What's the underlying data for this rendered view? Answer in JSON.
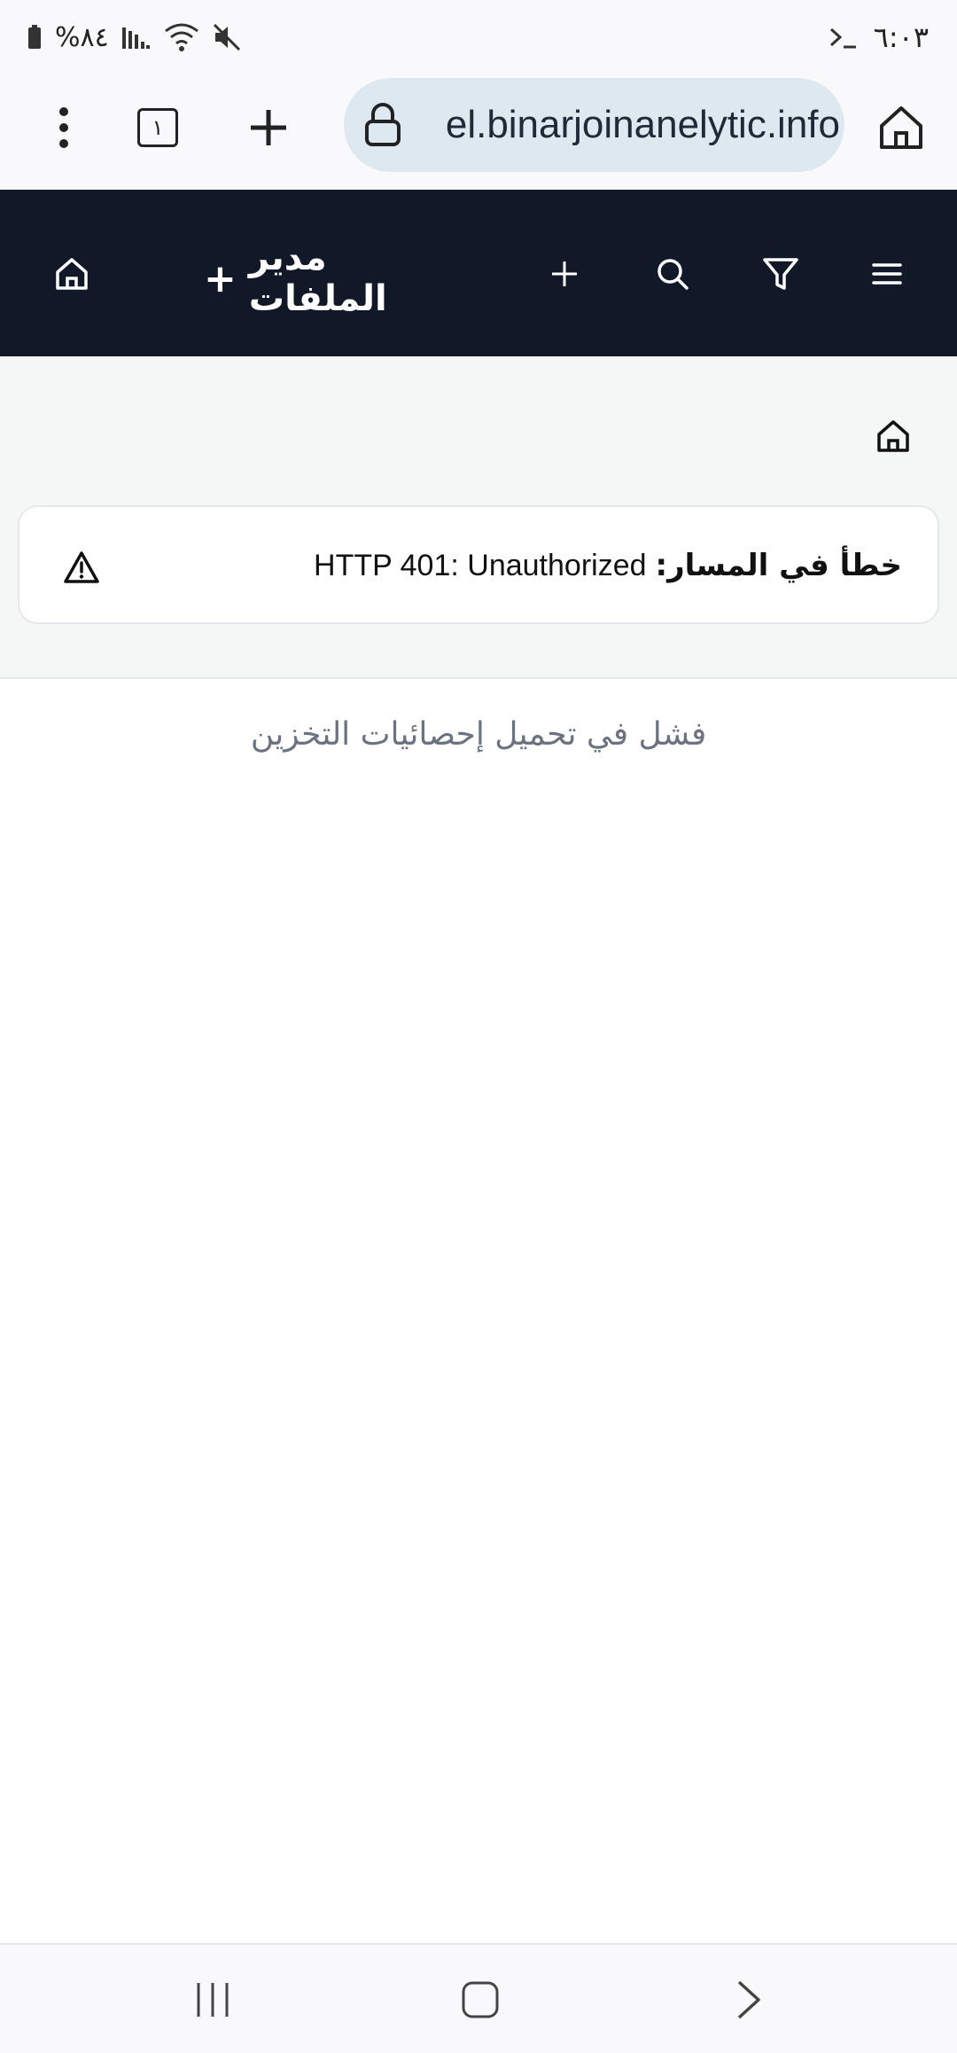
{
  "status_bar": {
    "time": "٦:٠٣",
    "battery": "%٨٤",
    "terminal_icon": "terminal-icon",
    "icons": [
      "battery-icon",
      "signal-icon",
      "wifi-icon",
      "mute-icon"
    ]
  },
  "browser": {
    "url": "el.binarjoinanelytic.info",
    "tab_count": "١",
    "icons": [
      "home-icon",
      "lock-icon",
      "plus-icon",
      "tabs-icon",
      "more-vert-icon"
    ]
  },
  "header": {
    "title": "مدير الملفات",
    "title_plus": "+",
    "icons": [
      "menu-icon",
      "filter-icon",
      "search-icon",
      "plus-icon",
      "home-icon"
    ],
    "background": "#111827"
  },
  "breadcrumb": {
    "icon": "home-icon"
  },
  "error": {
    "label": "خطأ في المسار:",
    "detail": "HTTP 401: Unauthorized",
    "icon": "warning-icon"
  },
  "storage": {
    "message": "فشل في تحميل إحصائيات التخزين"
  },
  "nav": {
    "icons": [
      "recents-icon",
      "home-nav-icon",
      "back-icon"
    ]
  }
}
